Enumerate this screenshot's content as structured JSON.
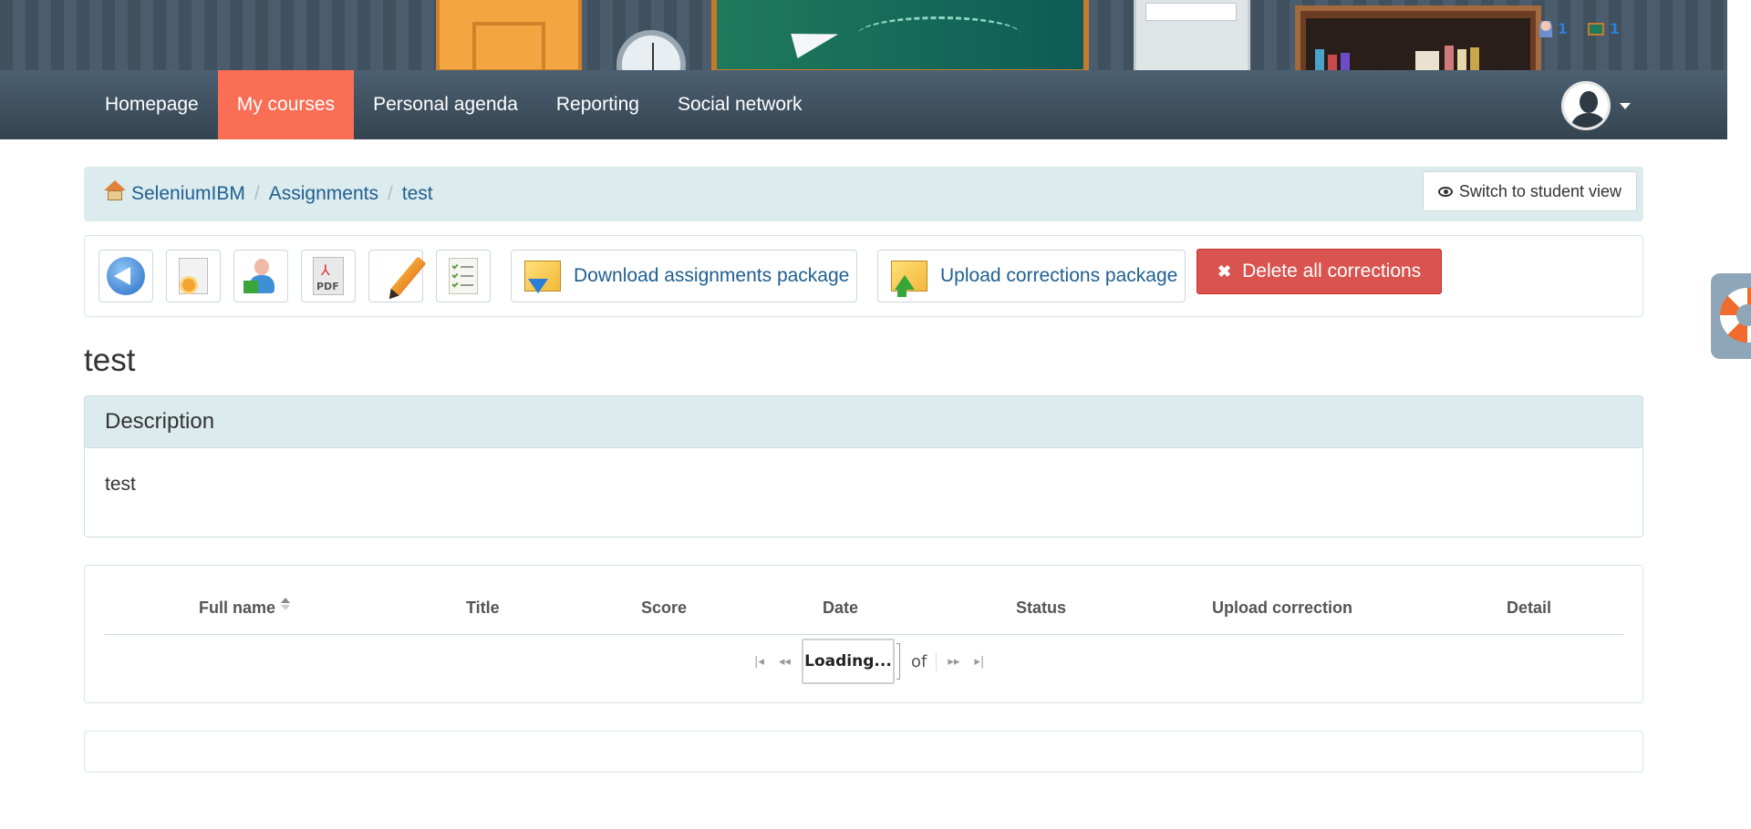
{
  "banner": {
    "online_users_count": "1",
    "online_courses_count": "1"
  },
  "navbar": {
    "items": [
      {
        "label": "Homepage"
      },
      {
        "label": "My courses"
      },
      {
        "label": "Personal agenda"
      },
      {
        "label": "Reporting"
      },
      {
        "label": "Social network"
      }
    ],
    "active_index": 1
  },
  "breadcrumb": {
    "items": [
      "SeleniumIBM",
      "Assignments",
      "test"
    ],
    "switch_label": "Switch to student view"
  },
  "toolbar": {
    "download_label": "Download assignments package",
    "upload_label": "Upload corrections package",
    "delete_label": "Delete all corrections",
    "pdf_icon_text": "PDF"
  },
  "page": {
    "title": "test",
    "description_heading": "Description",
    "description_text": "test"
  },
  "table": {
    "columns": [
      "Full name",
      "Title",
      "Score",
      "Date",
      "Status",
      "Upload correction",
      "Detail"
    ],
    "sorted_column": "Full name",
    "pager": {
      "page_input": "Loading...",
      "of_label": "of"
    }
  },
  "colors": {
    "nav_active": "#fa6e55",
    "navbar": "#3e4f5d",
    "link": "#1f5f91",
    "danger": "#d9534f",
    "panel_head": "#dcebed"
  }
}
